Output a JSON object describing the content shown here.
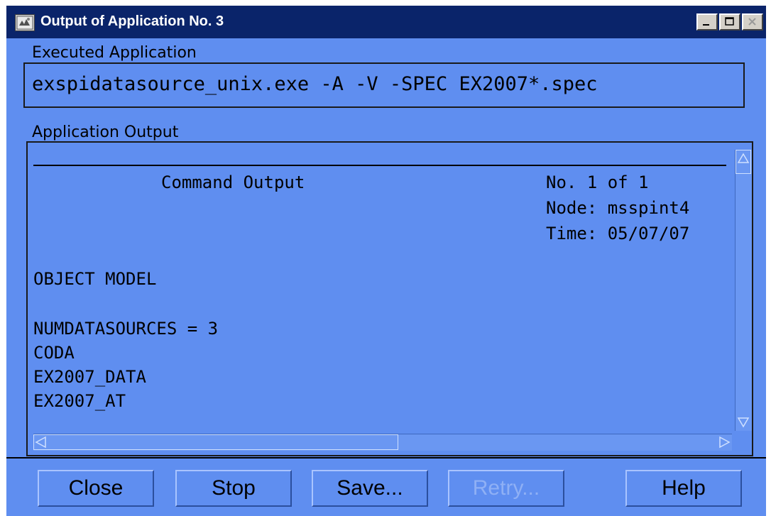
{
  "window": {
    "title": "Output of Application No. 3",
    "icon": "app-icon"
  },
  "executed": {
    "label": "Executed Application",
    "command": "exspidatasource_unix.exe -A -V -SPEC EX2007*.spec"
  },
  "output": {
    "label": "Application Output",
    "heading": "Command Output",
    "number_line": "No. 1 of 1",
    "node_line": "Node: msspint4",
    "time_line": "Time: 05/07/07",
    "lines": [
      "OBJECT MODEL",
      "",
      "NUMDATASOURCES = 3",
      "CODA",
      "EX2007_DATA",
      "EX2007_AT"
    ]
  },
  "buttons": {
    "close": "Close",
    "stop": "Stop",
    "save": "Save...",
    "retry": "Retry...",
    "help": "Help"
  },
  "colors": {
    "window_bg": "#5f8ef0",
    "titlebar": "#0a246a"
  }
}
